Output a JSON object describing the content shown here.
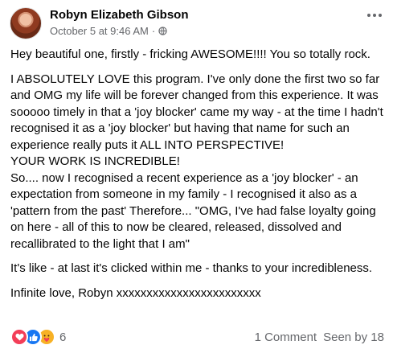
{
  "author": {
    "name": "Robyn Elizabeth Gibson"
  },
  "meta": {
    "timestamp": "October 5 at 9:46 AM",
    "separator": "·",
    "privacy_icon": "globe-icon"
  },
  "post": {
    "paragraphs": [
      "Hey beautiful one, firstly - fricking AWESOME!!!!  You so totally rock.",
      "I ABSOLUTELY LOVE this program.  I've only done the first two so far and OMG my life will be forever changed from this experience. It was sooooo timely in that a 'joy blocker' came my way - at the time I hadn't recognised it as a 'joy blocker' but having that name for such an experience really puts it ALL INTO PERSPECTIVE!\nYOUR WORK IS INCREDIBLE!\nSo.... now I recognised a recent experience as a 'joy blocker' - an expectation from someone in my family - I recognised it also as a 'pattern from the past' Therefore... \"OMG, I've had false loyalty going on here - all of this to now be cleared, released, dissolved and recallibrated to the light that I am\"",
      "It's like - at last it's clicked within me - thanks to your incredibleness.",
      "Infinite love, Robyn xxxxxxxxxxxxxxxxxxxxxxxx"
    ]
  },
  "reactions": {
    "icons": [
      "love-icon",
      "like-icon",
      "care-icon"
    ],
    "count": "6"
  },
  "stats": {
    "comments": "1 Comment",
    "seen": "Seen by 18"
  },
  "colors": {
    "love": "#f33e58",
    "like": "#1877f2",
    "care": "#f7b125",
    "secondary_text": "#65676b"
  }
}
